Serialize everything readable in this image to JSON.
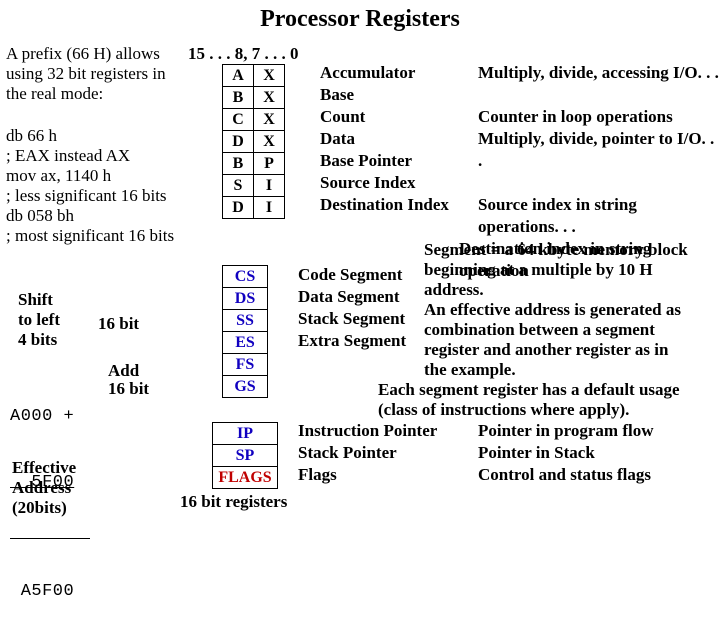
{
  "title": "Processor Registers",
  "prefix_note": {
    "l1": "A prefix (66 H) allows",
    "l2": "using 32 bit registers in",
    "l3": "the real mode:"
  },
  "bits_label": "15 . . . 8, 7 . . . 0",
  "gp_regs": {
    "r0a": "A",
    "r0b": "X",
    "r1a": "B",
    "r1b": "X",
    "r2a": "C",
    "r2b": "X",
    "r3a": "D",
    "r3b": "X",
    "r4a": "B",
    "r4b": "P",
    "r5a": "S",
    "r5b": "I",
    "r6a": "D",
    "r6b": "I"
  },
  "gp_desc": {
    "d0": "Accumulator",
    "d1": "Base",
    "d2": "Count",
    "d3": "Data",
    "d4": "Base Pointer",
    "d5": "Source Index",
    "d6": "Destination Index"
  },
  "gp_right": {
    "r0": "Multiply, divide, accessing I/O. . .",
    "r2": "Counter in loop operations",
    "r3": "Multiply, divide, pointer to I/O. . .",
    "r5": "Source index in string operations. . .",
    "r6": "Destination index in string operation"
  },
  "asm": {
    "l1": "db 66 h",
    "l2": "; EAX instead AX",
    "l3": "mov ax, 1140 h",
    "l4": "; less significant 16 bits",
    "l5": "db 058 bh",
    "l6": "; most significant 16 bits"
  },
  "shift": {
    "l1": "Shift",
    "l2": "to left",
    "l3": "4 bits",
    "note": "16 bit"
  },
  "add": {
    "r1": "A000 +",
    "r2": "  5F00",
    "r3": " A5F00",
    "note1": "Add",
    "note2": "16 bit"
  },
  "eff": {
    "l1": "Effective",
    "l2": "Address",
    "l3": "(20bits)"
  },
  "seg_regs": {
    "s0": "CS",
    "s1": "DS",
    "s2": "SS",
    "s3": "ES",
    "s4": "FS",
    "s5": "GS"
  },
  "seg_desc": {
    "d0": "Code Segment",
    "d1": "Data Segment",
    "d2": "Stack Segment",
    "d3": "Extra Segment"
  },
  "seg_para": {
    "l0": "Segment = a 64 kbyte memory block",
    "l1": "beginning at a multiple by 10 H",
    "l2": "address.",
    "l3": "An effective address is generated as",
    "l4": "combination between a segment",
    "l5": "register and another register as in",
    "l6": "the example.",
    "l7": "Each segment register has a default usage",
    "l8": "(class of instructions where apply)."
  },
  "misc_regs": {
    "m0": "IP",
    "m1": "SP",
    "m2": "FLAGS"
  },
  "misc_desc": {
    "d0": "Instruction Pointer",
    "d1": "Stack Pointer",
    "d2": "Flags"
  },
  "misc_right": {
    "r0": "Pointer in program flow",
    "r1": "Pointer in Stack",
    "r2": "Control and status flags"
  },
  "bottom_label": "16 bit registers"
}
